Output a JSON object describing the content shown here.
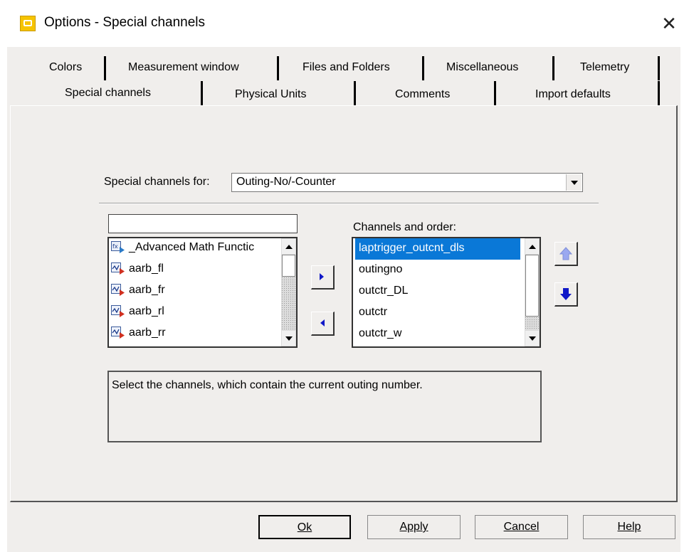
{
  "window": {
    "title": "Options - Special channels",
    "close_glyph": "✕"
  },
  "tabs": {
    "row1": [
      "Colors",
      "Measurement window",
      "Files and Folders",
      "Miscellaneous",
      "Telemetry"
    ],
    "row2": [
      "Special channels",
      "Physical Units",
      "Comments",
      "Import defaults"
    ],
    "active": "Special channels"
  },
  "special_channels_for": {
    "label": "Special channels for:",
    "value": "Outing-No/-Counter"
  },
  "available_channels": {
    "filter_value": "",
    "items": [
      {
        "label": "_Advanced Math Functic",
        "icon": "formula-icon"
      },
      {
        "label": "aarb_fl",
        "icon": "signal-channel-icon"
      },
      {
        "label": "aarb_fr",
        "icon": "signal-channel-icon"
      },
      {
        "label": "aarb_rl",
        "icon": "signal-channel-icon"
      },
      {
        "label": "aarb_rr",
        "icon": "signal-channel-icon"
      }
    ]
  },
  "channels_and_order": {
    "label": "Channels and order:",
    "items": [
      "laptrigger_outcnt_dls",
      "outingno",
      "outctr_DL",
      "outctr",
      "outctr_w"
    ],
    "selected_index": 0
  },
  "description": "Select the channels, which contain the current outing number.",
  "buttons": {
    "ok": "Ok",
    "apply": "Apply",
    "cancel": "Cancel",
    "help": "Help"
  },
  "colors": {
    "selection": "#0a78d7",
    "arrow_blue": "#1018c8",
    "app_icon": "#f6c400"
  }
}
